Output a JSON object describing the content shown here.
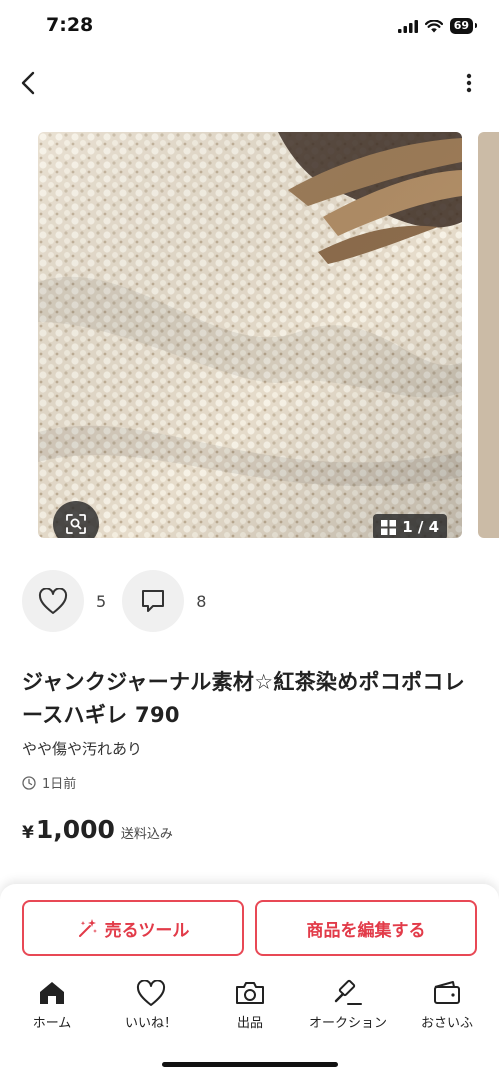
{
  "status_bar": {
    "time": "7:28",
    "battery": "69"
  },
  "product": {
    "image_counter": "1 / 4",
    "likes": "5",
    "comments": "8",
    "title": "ジャンクジャーナル素材☆紅茶染めポコポコレースハギレ 790",
    "condition": "やや傷や汚れあり",
    "posted": "1日前",
    "price_symbol": "¥",
    "price": "1,000",
    "price_note": "送料込み"
  },
  "actions": {
    "sell_tool": "売るツール",
    "edit": "商品を編集する"
  },
  "tabs": [
    {
      "label": "ホーム",
      "icon": "home-icon"
    },
    {
      "label": "いいね！",
      "icon": "heart-icon"
    },
    {
      "label": "出品",
      "icon": "camera-icon"
    },
    {
      "label": "オークション",
      "icon": "gavel-icon"
    },
    {
      "label": "おさいふ",
      "icon": "wallet-icon"
    }
  ],
  "colors": {
    "accent": "#e23b49",
    "text": "#222222",
    "panel": "#f0f0f0"
  }
}
